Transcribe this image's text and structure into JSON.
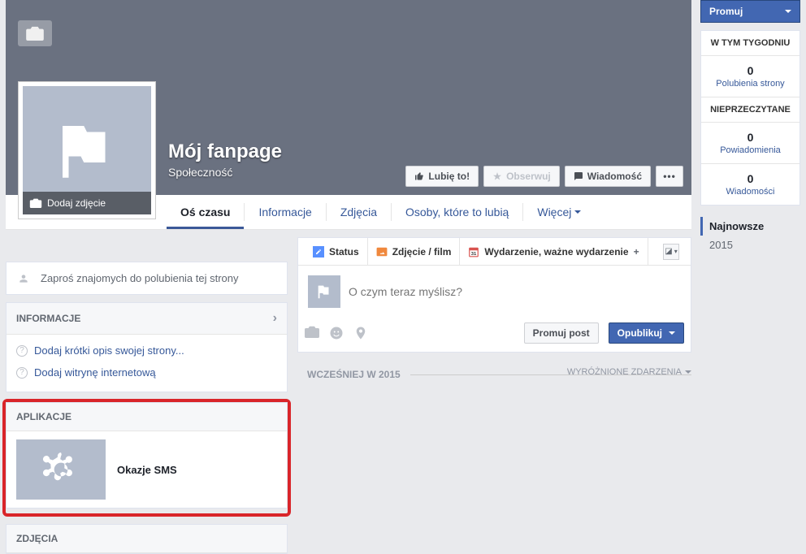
{
  "cover": {
    "add_photo_label": "Dodaj zdjęcie",
    "page_title": "Mój fanpage",
    "page_category": "Społeczność",
    "actions": {
      "like": "Lubię to!",
      "follow": "Obserwuj",
      "message": "Wiadomość",
      "more": "•••"
    }
  },
  "nav": {
    "timeline": "Oś czasu",
    "about": "Informacje",
    "photos": "Zdjęcia",
    "likes": "Osoby, które to lubią",
    "more": "Więcej"
  },
  "sidebar": {
    "invite": "Zaproś znajomych do polubienia tej strony",
    "info_header": "INFORMACJE",
    "info": {
      "add_desc": "Dodaj krótki opis swojej strony...",
      "add_site": "Dodaj witrynę internetową"
    },
    "apps_header": "APLIKACJE",
    "app1_label": "Okazje SMS",
    "photos_header": "ZDJĘCIA"
  },
  "composer": {
    "tabs": {
      "status": "Status",
      "photo": "Zdjęcie / film",
      "event": "Wydarzenie, ważne wydarzenie",
      "plus": "+"
    },
    "placeholder": "O czym teraz myślisz?",
    "promote": "Promuj post",
    "publish": "Opublikuj"
  },
  "feed": {
    "earlier": "WCZEŚNIEJ W 2015",
    "filter": "WYRÓŻNIONE ZDARZENIA"
  },
  "right": {
    "promote": "Promuj",
    "week_header": "W TYM TYGODNIU",
    "stats": {
      "likes_num": "0",
      "likes_lbl": "Polubienia strony",
      "unread_header": "NIEPRZECZYTANE",
      "notif_num": "0",
      "notif_lbl": "Powiadomienia",
      "msg_num": "0",
      "msg_lbl": "Wiadomości"
    },
    "list": {
      "latest": "Najnowsze",
      "year": "2015"
    }
  }
}
